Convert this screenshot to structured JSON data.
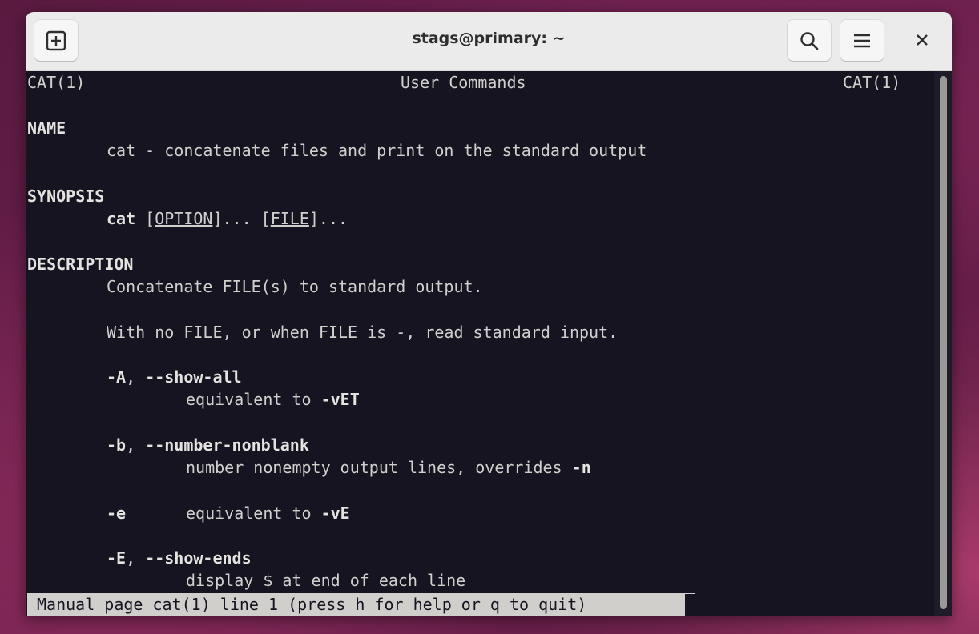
{
  "window": {
    "title": "stags@primary: ~",
    "icons": {
      "new_tab": "new-tab-icon",
      "search": "search-icon",
      "menu": "hamburger-menu-icon",
      "close": "close-icon"
    }
  },
  "man": {
    "header_left": "CAT(1)",
    "header_center": "User Commands",
    "header_right": "CAT(1)",
    "name_heading": "NAME",
    "name_text": "cat - concatenate files and print on the standard output",
    "synopsis_heading": "SYNOPSIS",
    "synopsis_cmd": "cat",
    "synopsis_option": "OPTION",
    "synopsis_file": "FILE",
    "description_heading": "DESCRIPTION",
    "desc_line1": "Concatenate FILE(s) to standard output.",
    "desc_line2": "With no FILE, or when FILE is -, read standard input.",
    "opt_A_flags": "-A",
    "opt_A_long": "--show-all",
    "opt_A_desc": "equivalent to",
    "opt_A_ref": "-vET",
    "opt_b_flags": "-b",
    "opt_b_long": "--number-nonblank",
    "opt_b_desc": "number nonempty output lines, overrides",
    "opt_b_ref": "-n",
    "opt_e_flags": "-e",
    "opt_e_desc": "equivalent to",
    "opt_e_ref": "-vE",
    "opt_E_flags": "-E",
    "opt_E_long": "--show-ends",
    "opt_E_desc": "display $ at end of each line"
  },
  "status_bar": "Manual page cat(1) line 1 (press h for help or q to quit)",
  "colors": {
    "terminal_bg": "#171421",
    "terminal_fg": "#d0cfcc",
    "titlebar_bg": "#ebebeb"
  }
}
